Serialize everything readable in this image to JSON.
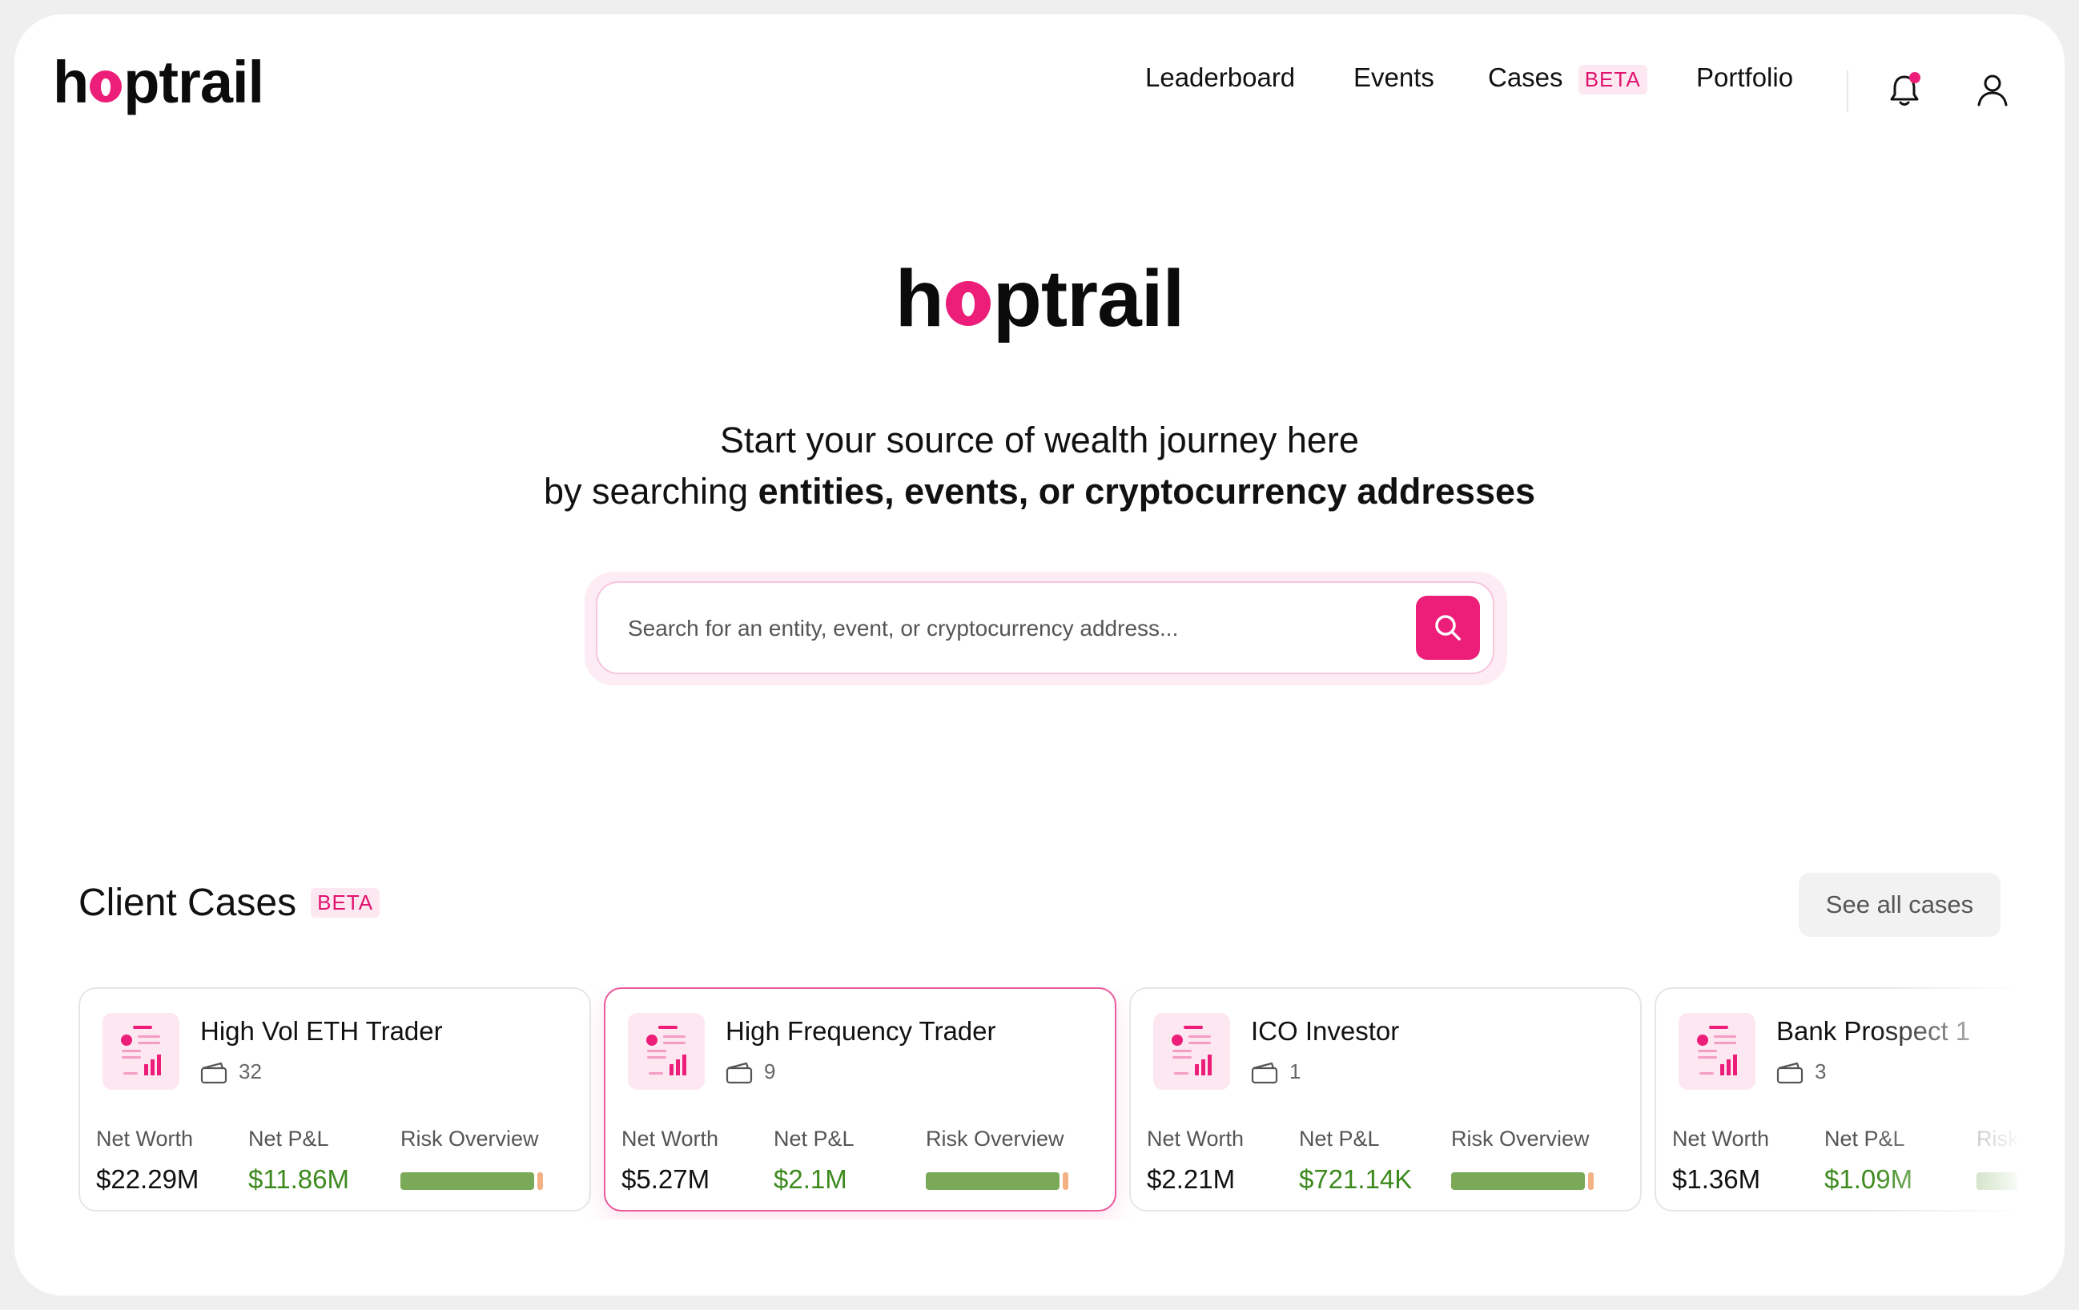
{
  "header": {
    "logo_prefix": "h",
    "logo_suffix": "ptrail",
    "nav": [
      {
        "label": "Leaderboard"
      },
      {
        "label": "Events"
      },
      {
        "label": "Cases",
        "badge": "BETA"
      },
      {
        "label": "Portfolio"
      }
    ],
    "notification_icon": "bell-icon",
    "profile_icon": "user-icon",
    "accent_color": "#ec1e79"
  },
  "hero": {
    "logo_prefix": "h",
    "logo_suffix": "ptrail",
    "tagline_line1": "Start your source of wealth journey here",
    "tagline_line2_prefix": "by searching ",
    "tagline_line2_bold": "entities, events, or cryptocurrency addresses",
    "search_placeholder": "Search for an entity, event, or cryptocurrency address..."
  },
  "cases": {
    "title": "Client Cases",
    "badge": "BETA",
    "see_all_label": "See all cases",
    "labels": {
      "net_worth": "Net Worth",
      "net_pnl": "Net P&L",
      "risk": "Risk Overview"
    },
    "items": [
      {
        "name": "High Vol ETH Trader",
        "wallets": "32",
        "net_worth": "$22.29M",
        "net_pnl": "$11.86M",
        "risk_low_fraction": 0.96
      },
      {
        "name": "High Frequency Trader",
        "wallets": "9",
        "net_worth": "$5.27M",
        "net_pnl": "$2.1M",
        "risk_low_fraction": 0.96
      },
      {
        "name": "ICO Investor",
        "wallets": "1",
        "net_worth": "$2.21M",
        "net_pnl": "$721.14K",
        "risk_low_fraction": 0.96
      },
      {
        "name": "Bank Prospect 1",
        "wallets": "3",
        "net_worth": "$1.36M",
        "net_pnl": "$1.09M",
        "risk_low_fraction": 0.96
      }
    ]
  }
}
